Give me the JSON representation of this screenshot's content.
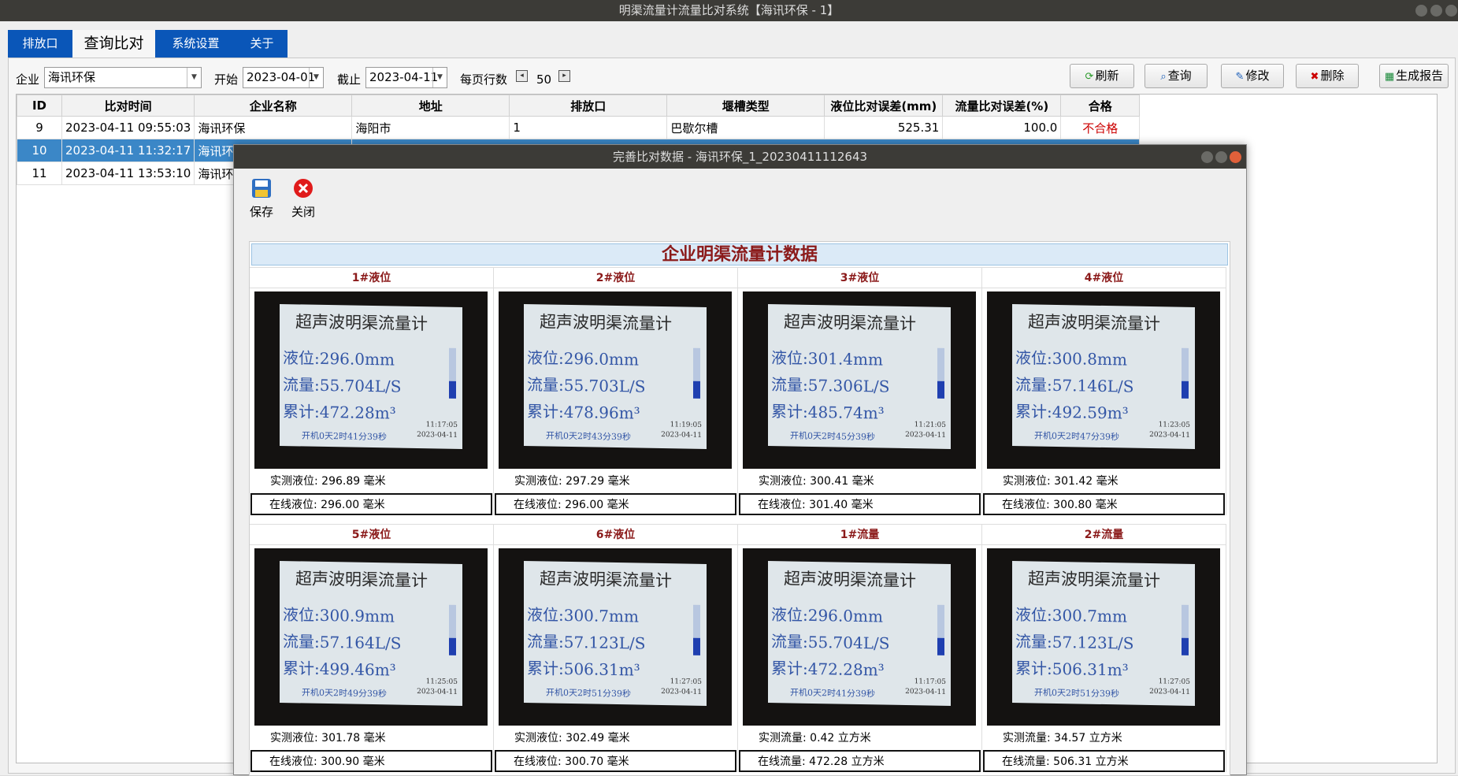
{
  "window": {
    "title": "明渠流量计流量比对系统【海讯环保 - 1】"
  },
  "tabs": [
    "排放口",
    "查询比对",
    "系统设置",
    "关于"
  ],
  "filters": {
    "company_label": "企业",
    "company_value": "海讯环保",
    "start_label": "开始",
    "start_value": "2023-04-01",
    "end_label": "截止",
    "end_value": "2023-04-11",
    "rows_label": "每页行数",
    "rows_value": "50"
  },
  "toolbar": {
    "refresh": "刷新",
    "query": "查询",
    "edit": "修改",
    "delete": "删除",
    "report": "生成报告"
  },
  "table": {
    "columns": [
      "ID",
      "比对时间",
      "企业名称",
      "地址",
      "排放口",
      "堰槽类型",
      "液位比对误差(mm)",
      "流量比对误差(%)",
      "合格"
    ],
    "rows": [
      [
        "9",
        "2023-04-11 09:55:03",
        "海讯环保",
        "海阳市",
        "1",
        "巴歇尔槽",
        "525.31",
        "100.0",
        "不合格"
      ],
      [
        "10",
        "2023-04-11 11:32:17",
        "海讯环保",
        "",
        "",
        "",
        "",
        "",
        ""
      ],
      [
        "11",
        "2023-04-11 13:53:10",
        "海讯环保",
        "",
        "",
        "",
        "",
        "",
        ""
      ]
    ]
  },
  "dialog": {
    "title": "完善比对数据 - 海讯环保_1_20230411112643",
    "save_label": "保存",
    "close_label": "关闭",
    "panel_title": "企业明渠流量计数据",
    "photo_title": "超声波明渠流量计",
    "cells": [
      {
        "head": "1#液位",
        "level": "液位:296.0mm",
        "flow": "流量:55.704L/S",
        "total": "累计:472.28m³",
        "time": "11:17:05",
        "date": "2023-04-11",
        "footer": "开机0天2时41分39秒",
        "meas_label": "实测液位:",
        "meas_val": "296.89",
        "meas_unit": "毫米",
        "onl_label": "在线液位:",
        "onl_val": "296.00",
        "onl_unit": "毫米"
      },
      {
        "head": "2#液位",
        "level": "液位:296.0mm",
        "flow": "流量:55.703L/S",
        "total": "累计:478.96m³",
        "time": "11:19:05",
        "date": "2023-04-11",
        "footer": "开机0天2时43分39秒",
        "meas_label": "实测液位:",
        "meas_val": "297.29",
        "meas_unit": "毫米",
        "onl_label": "在线液位:",
        "onl_val": "296.00",
        "onl_unit": "毫米"
      },
      {
        "head": "3#液位",
        "level": "液位:301.4mm",
        "flow": "流量:57.306L/S",
        "total": "累计:485.74m³",
        "time": "11:21:05",
        "date": "2023-04-11",
        "footer": "开机0天2时45分39秒",
        "meas_label": "实测液位:",
        "meas_val": "300.41",
        "meas_unit": "毫米",
        "onl_label": "在线液位:",
        "onl_val": "301.40",
        "onl_unit": "毫米"
      },
      {
        "head": "4#液位",
        "level": "液位:300.8mm",
        "flow": "流量:57.146L/S",
        "total": "累计:492.59m³",
        "time": "11:23:05",
        "date": "2023-04-11",
        "footer": "开机0天2时47分39秒",
        "meas_label": "实测液位:",
        "meas_val": "301.42",
        "meas_unit": "毫米",
        "onl_label": "在线液位:",
        "onl_val": "300.80",
        "onl_unit": "毫米"
      },
      {
        "head": "5#液位",
        "level": "液位:300.9mm",
        "flow": "流量:57.164L/S",
        "total": "累计:499.46m³",
        "time": "11:25:05",
        "date": "2023-04-11",
        "footer": "开机0天2时49分39秒",
        "meas_label": "实测液位:",
        "meas_val": "301.78",
        "meas_unit": "毫米",
        "onl_label": "在线液位:",
        "onl_val": "300.90",
        "onl_unit": "毫米"
      },
      {
        "head": "6#液位",
        "level": "液位:300.7mm",
        "flow": "流量:57.123L/S",
        "total": "累计:506.31m³",
        "time": "11:27:05",
        "date": "2023-04-11",
        "footer": "开机0天2时51分39秒",
        "meas_label": "实测液位:",
        "meas_val": "302.49",
        "meas_unit": "毫米",
        "onl_label": "在线液位:",
        "onl_val": "300.70",
        "onl_unit": "毫米"
      },
      {
        "head": "1#流量",
        "level": "液位:296.0mm",
        "flow": "流量:55.704L/S",
        "total": "累计:472.28m³",
        "time": "11:17:05",
        "date": "2023-04-11",
        "footer": "开机0天2时41分39秒",
        "meas_label": "实测流量:",
        "meas_val": "0.42",
        "meas_unit": "立方米",
        "onl_label": "在线流量:",
        "onl_val": "472.28",
        "onl_unit": "立方米"
      },
      {
        "head": "2#流量",
        "level": "液位:300.7mm",
        "flow": "流量:57.123L/S",
        "total": "累计:506.31m³",
        "time": "11:27:05",
        "date": "2023-04-11",
        "footer": "开机0天2时51分39秒",
        "meas_label": "实测流量:",
        "meas_val": "34.57",
        "meas_unit": "立方米",
        "onl_label": "在线流量:",
        "onl_val": "506.31",
        "onl_unit": "立方米"
      }
    ]
  },
  "colors": {
    "tab_blue": "#0a56b8",
    "selection": "#3b87c7",
    "fail_red": "#cc0000",
    "header_red": "#8b1a1a"
  }
}
